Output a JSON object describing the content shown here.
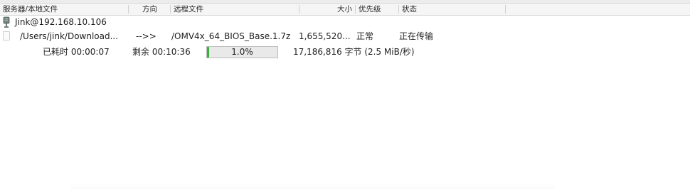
{
  "header": {
    "columns": {
      "local_file": "服务器/本地文件",
      "direction": "方向",
      "remote_file": "远程文件",
      "size": "大小",
      "priority": "优先级",
      "status": "状态"
    }
  },
  "queue": {
    "server": {
      "icon": "server-icon",
      "label": "Jink@192.168.10.106"
    },
    "transfer": {
      "icon": "file-icon",
      "local_file": "/Users/jink/Download...",
      "direction": "-->>",
      "remote_file": "/OMV4x_64_BIOS_Base.1.7z",
      "size": "1,655,520...",
      "priority": "正常",
      "status": "正在传输"
    },
    "progress": {
      "elapsed": "已耗时 00:00:07",
      "remaining": "剩余 00:10:36",
      "percent_label": "1.0%",
      "percent": 1.0,
      "bytes": "17,186,816 字节 (2.5 MiB/秒)",
      "fill_color": "#35b33a"
    }
  }
}
